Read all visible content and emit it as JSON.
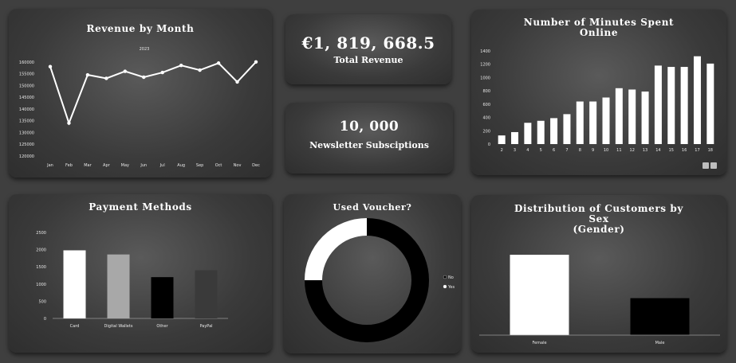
{
  "kpis": {
    "total_revenue": {
      "value": "€1, 819, 668.5",
      "label": "Total Revenue"
    },
    "newsletter": {
      "value": "10, 000",
      "label": "Newsletter Subsciptions"
    }
  },
  "chart_data": [
    {
      "id": "revenue-by-month",
      "type": "line",
      "title": "Revenue by Month",
      "legend": [
        "2023"
      ],
      "categories": [
        "Jan",
        "Feb",
        "Mar",
        "Apr",
        "May",
        "Jun",
        "Jul",
        "Aug",
        "Sep",
        "Oct",
        "Nov",
        "Dec"
      ],
      "values": [
        158000,
        134000,
        154500,
        153000,
        156000,
        153500,
        155500,
        158500,
        156500,
        159500,
        151500,
        160000
      ],
      "y_ticks": [
        "120000",
        "125000",
        "130000",
        "135000",
        "140000",
        "145000",
        "150000",
        "155000",
        "160000"
      ],
      "ylim": [
        120000,
        165000
      ],
      "color": "#ffffff"
    },
    {
      "id": "minutes-online",
      "type": "bar",
      "title": "Number of Minutes Spent Online",
      "categories": [
        "2",
        "3",
        "4",
        "5",
        "6",
        "7",
        "8",
        "9",
        "10",
        "11",
        "12",
        "13",
        "14",
        "15",
        "16",
        "17",
        "18"
      ],
      "values": [
        130,
        180,
        320,
        350,
        390,
        450,
        640,
        640,
        700,
        840,
        820,
        790,
        1180,
        1160,
        1160,
        1320,
        1210
      ],
      "y_ticks": [
        "0",
        "200",
        "400",
        "600",
        "800",
        "1000",
        "1200",
        "1400"
      ],
      "ylim": [
        0,
        1400
      ],
      "color": "#ffffff"
    },
    {
      "id": "payment-methods",
      "type": "bar",
      "title": "Payment Methods",
      "categories": [
        "Card",
        "Digital Wallets",
        "Other",
        "PayPal"
      ],
      "values": [
        1980,
        1860,
        1200,
        1400
      ],
      "colors": [
        "#ffffff",
        "#a8a8a8",
        "#000000",
        "#3a3a3a"
      ],
      "y_ticks": [
        "0",
        "500",
        "1000",
        "1500",
        "2000",
        "2500"
      ],
      "ylim": [
        0,
        2500
      ]
    },
    {
      "id": "used-voucher",
      "type": "pie",
      "title": "Used Voucher?",
      "labels": [
        "No",
        "Yes"
      ],
      "values": [
        75,
        25
      ],
      "colors": [
        "#000000",
        "#ffffff"
      ],
      "legend_placement": "right"
    },
    {
      "id": "customers-by-sex",
      "type": "bar",
      "title": "Distribution of Customers by Sex (Gender)",
      "title_lines": [
        "Distribution of Customers by",
        "Sex",
        "(Gender)"
      ],
      "categories": [
        "Female",
        "Male"
      ],
      "values": [
        100,
        46
      ],
      "colors": [
        "#ffffff",
        "#000000"
      ]
    }
  ]
}
